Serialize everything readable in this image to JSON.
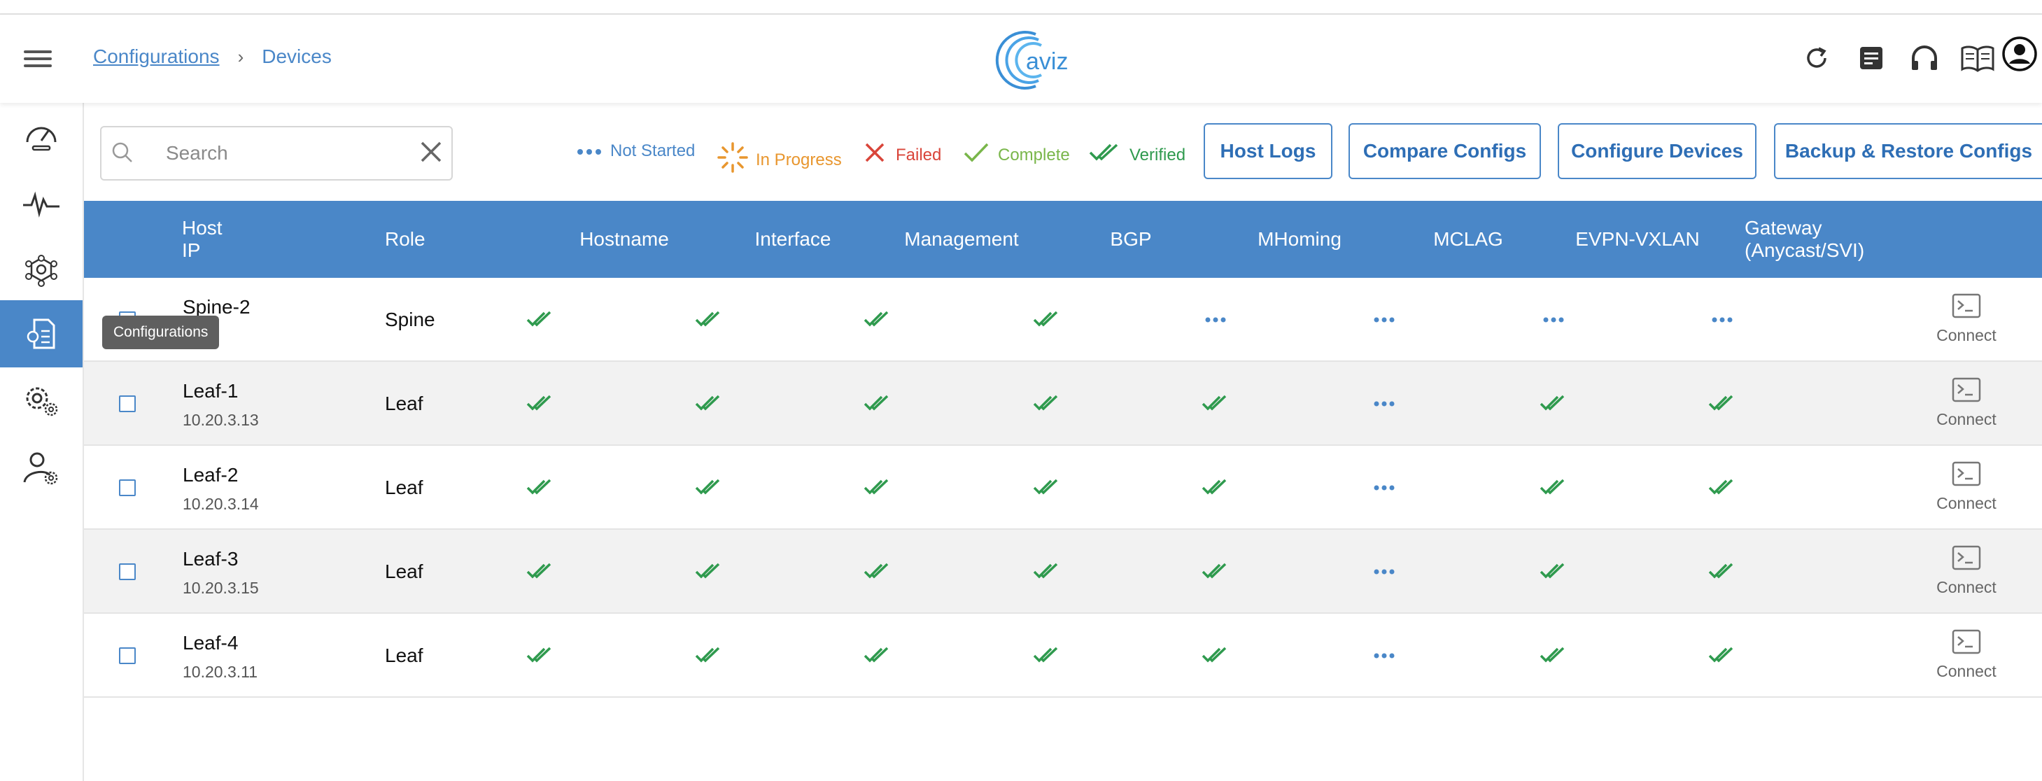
{
  "breadcrumb": {
    "parent": "Configurations",
    "separator": "›",
    "current": "Devices"
  },
  "logo_text": "aviz",
  "header_icons": [
    "refresh-icon",
    "notes-icon",
    "headset-icon",
    "book-icon",
    "user-account-icon"
  ],
  "sidebar": {
    "items": [
      "dashboard-icon",
      "pulse-icon",
      "network-icon",
      "configurations-icon",
      "settings-icon",
      "user-settings-icon"
    ],
    "active": "configurations-icon",
    "tooltip": "Configurations"
  },
  "search": {
    "placeholder": "Search",
    "value": ""
  },
  "legend": {
    "not_started": "Not Started",
    "in_progress": "In Progress",
    "failed": "Failed",
    "complete": "Complete",
    "verified": "Verified"
  },
  "colors": {
    "accent": "#4a87c8",
    "not_started": "#4a87c8",
    "in_progress": "#e8962e",
    "failed": "#d9453a",
    "complete": "#79b64a",
    "verified": "#2f9a4e"
  },
  "buttons": {
    "host_logs": "Host Logs",
    "compare_configs": "Compare Configs",
    "configure_devices": "Configure Devices",
    "backup_restore": "Backup & Restore Configs"
  },
  "table": {
    "headers": {
      "host": "Host",
      "ip": "IP",
      "role": "Role",
      "hostname": "Hostname",
      "interface": "Interface",
      "management": "Management",
      "bgp": "BGP",
      "mhoming": "MHoming",
      "mclag": "MCLAG",
      "evpn": "EVPN-VXLAN",
      "gateway_1": "Gateway",
      "gateway_2": "(Anycast/SVI)"
    },
    "connect_label": "Connect",
    "rows": [
      {
        "host": "Spine-2",
        "ip": "3.16",
        "role": "Spine",
        "statuses": [
          "verified",
          "verified",
          "verified",
          "verified",
          "not_started",
          "not_started",
          "not_started",
          "not_started"
        ]
      },
      {
        "host": "Leaf-1",
        "ip": "10.20.3.13",
        "role": "Leaf",
        "statuses": [
          "verified",
          "verified",
          "verified",
          "verified",
          "verified",
          "not_started",
          "verified",
          "verified"
        ]
      },
      {
        "host": "Leaf-2",
        "ip": "10.20.3.14",
        "role": "Leaf",
        "statuses": [
          "verified",
          "verified",
          "verified",
          "verified",
          "verified",
          "not_started",
          "verified",
          "verified"
        ]
      },
      {
        "host": "Leaf-3",
        "ip": "10.20.3.15",
        "role": "Leaf",
        "statuses": [
          "verified",
          "verified",
          "verified",
          "verified",
          "verified",
          "not_started",
          "verified",
          "verified"
        ]
      },
      {
        "host": "Leaf-4",
        "ip": "10.20.3.11",
        "role": "Leaf",
        "statuses": [
          "verified",
          "verified",
          "verified",
          "verified",
          "verified",
          "not_started",
          "verified",
          "verified"
        ]
      }
    ]
  }
}
